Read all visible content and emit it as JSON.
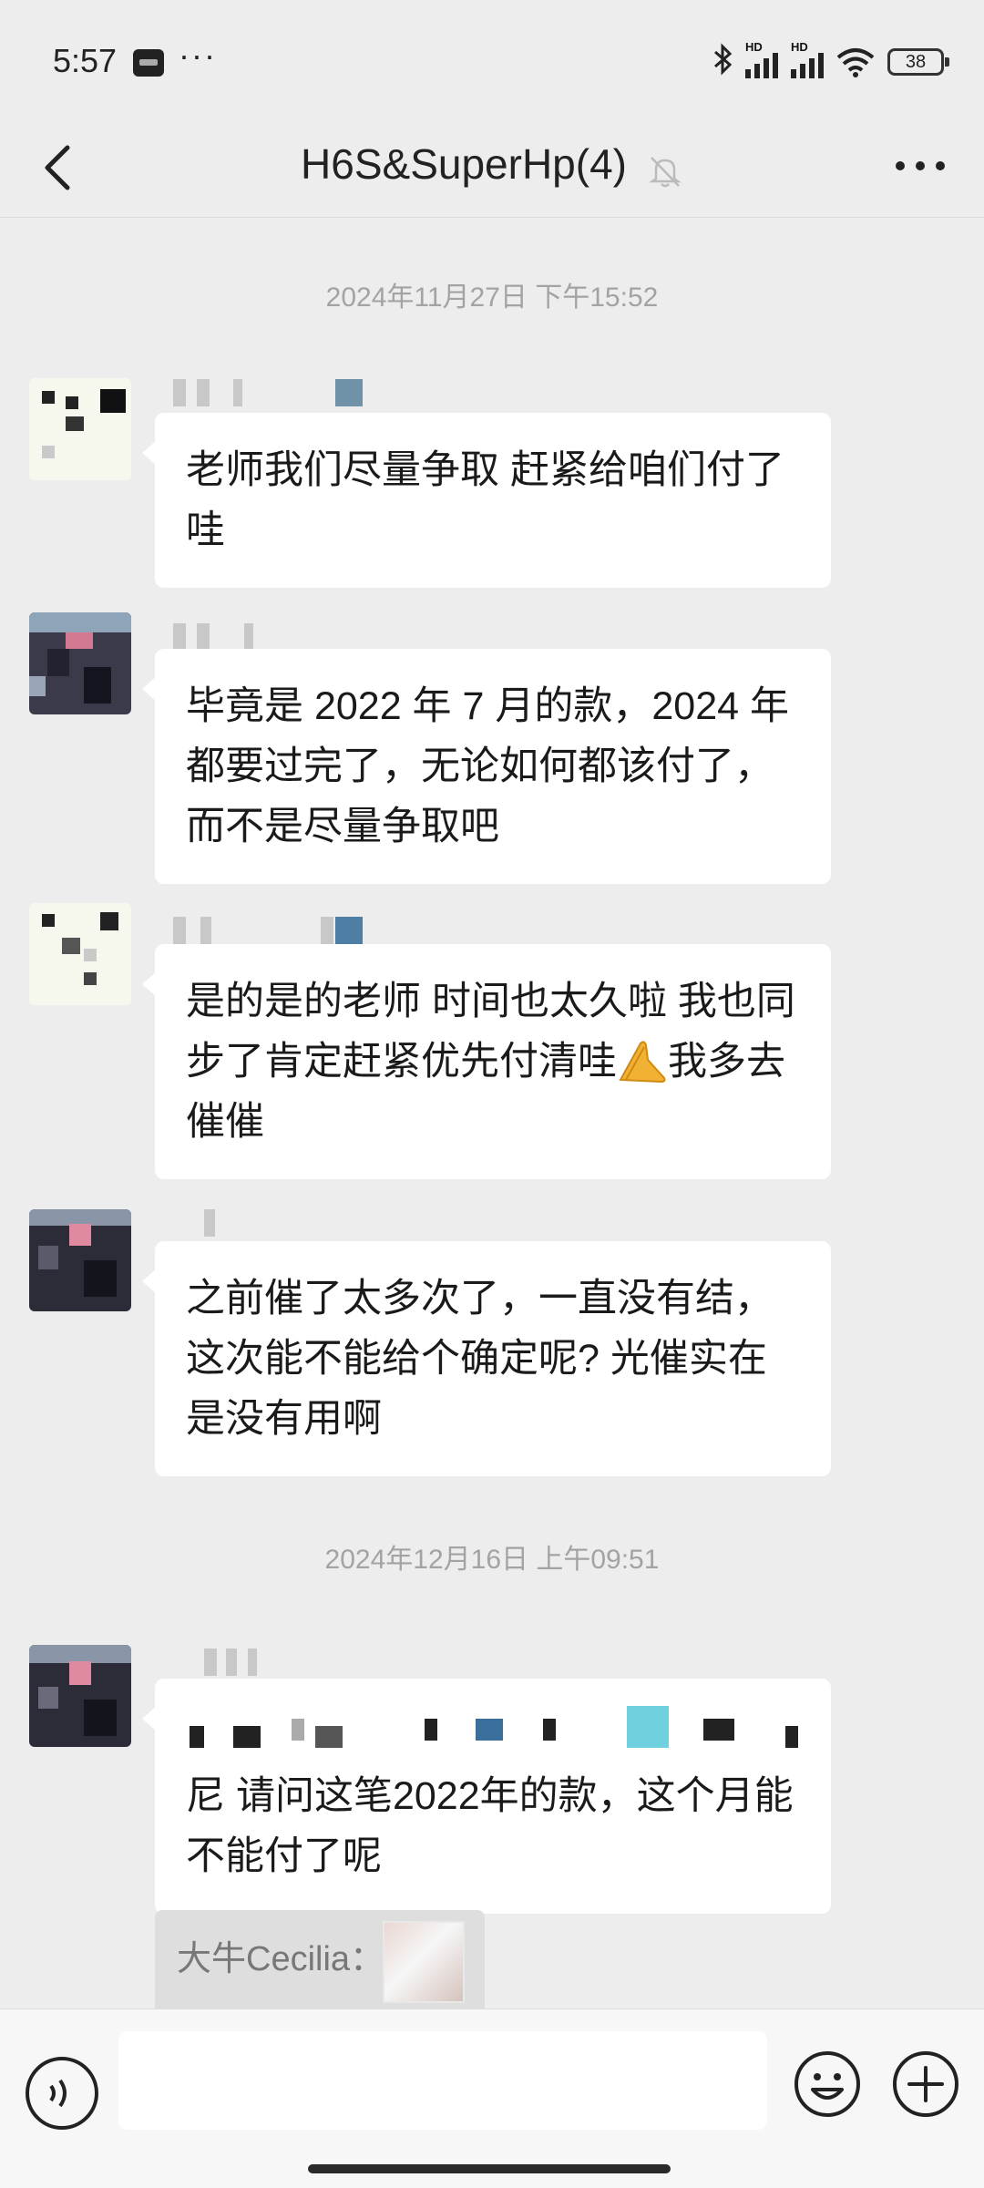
{
  "status_bar": {
    "time": "5:57",
    "dots": "···",
    "battery": "38",
    "hd1": "HD",
    "hd2": "HD"
  },
  "header": {
    "title": "H6S&SuperHp(4)",
    "back_icon": "chevron-left-icon",
    "mute_icon": "bell-off-icon",
    "more_icon": "ellipsis-icon"
  },
  "chat": {
    "timestamps": [
      "2024年11月27日 下午15:52",
      "2024年12月16日 上午09:51"
    ],
    "messages": [
      {
        "text": "老师我们尽量争取 赶紧给咱们付了哇"
      },
      {
        "text": "毕竟是 2022 年 7 月的款，2024 年都要过完了，无论如何都该付了，而不是尽量争取吧"
      },
      {
        "text_before": "是的是的老师 时间也太久啦 我也同步了肯定赶紧优先付清哇",
        "emoji": "palms-together-emoji",
        "text_after": "我多去催催"
      },
      {
        "text": "之前催了太多次了，一直没有结，这次能不能给个确定呢? 光催实在是没有用啊"
      },
      {
        "text_after_mosaic": "尼  请问这笔2022年的款，这个月能不能付了呢"
      }
    ],
    "quote": {
      "sender": "大牛Cecilia："
    }
  },
  "input_bar": {
    "placeholder": "",
    "voice_icon": "voice-icon",
    "emoji_icon": "smiley-icon",
    "plus_icon": "plus-circle-icon"
  }
}
